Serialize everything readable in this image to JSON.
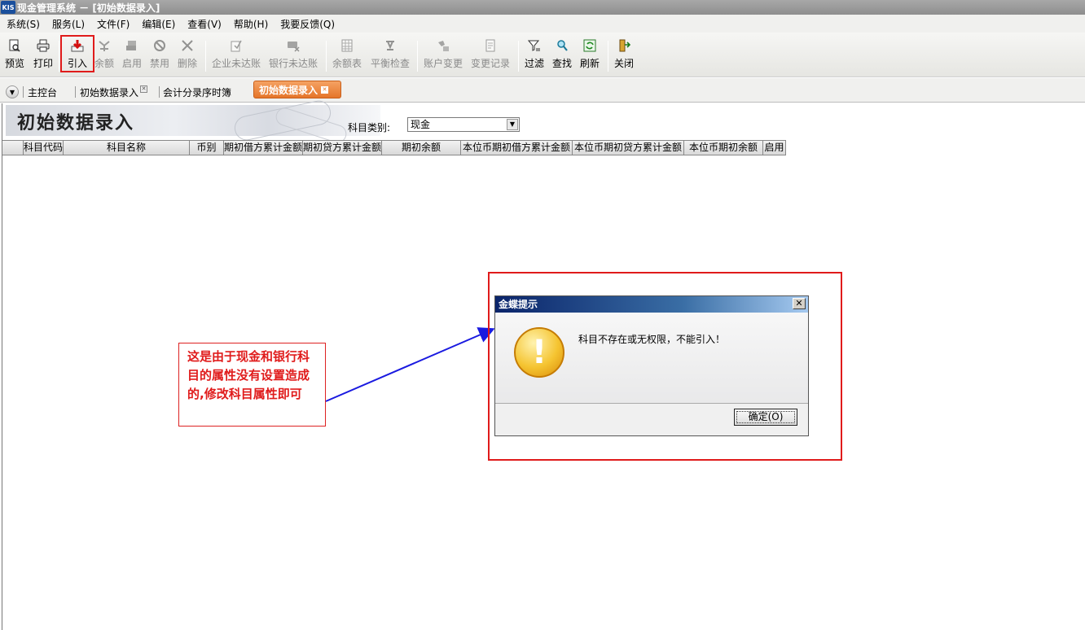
{
  "window": {
    "logo": "KIS",
    "title": "现金管理系统 － [初始数据录入]"
  },
  "menu": [
    {
      "label": "系统(S)"
    },
    {
      "label": "服务(L)"
    },
    {
      "label": "文件(F)"
    },
    {
      "label": "编辑(E)"
    },
    {
      "label": "查看(V)"
    },
    {
      "label": "帮助(H)"
    },
    {
      "label": "我要反馈(Q)"
    }
  ],
  "toolbar": {
    "preview": "预览",
    "print": "打印",
    "import": "引入",
    "balance": "余额",
    "enable": "启用",
    "disable": "禁用",
    "delete": "删除",
    "corp_unreached": "企业未达账",
    "bank_unreached": "银行未达账",
    "balance_table": "余额表",
    "balance_check": "平衡检查",
    "account_change": "账户变更",
    "change_log": "变更记录",
    "filter": "过滤",
    "find": "查找",
    "refresh": "刷新",
    "close": "关闭"
  },
  "tabs": {
    "console": "主控台",
    "tab1": "初始数据录入",
    "tab2": "会计分录序时簿",
    "active": "初始数据录入"
  },
  "page": {
    "heading": "初始数据录入",
    "account_type_label": "科目类别:",
    "account_type_value": "现金"
  },
  "grid_columns": [
    "",
    "科目代码",
    "科目名称",
    "币别",
    "期初借方累计金额",
    "期初贷方累计金额",
    "期初余额",
    "本位币期初借方累计金额",
    "本位币期初贷方累计金额",
    "本位币期初余额",
    "启用"
  ],
  "annotation": "这是由于现金和银行科目的属性没有设置造成的,修改科目属性即可",
  "dialog": {
    "title": "金蝶提示",
    "message": "科目不存在或无权限，不能引入！",
    "ok": "确定(O)",
    "close": "✕"
  },
  "colors": {
    "highlight": "#e01b1b",
    "active_tab": "#e5752a",
    "dialog_title": "#0a246a",
    "arrow": "#1a1ae0"
  }
}
